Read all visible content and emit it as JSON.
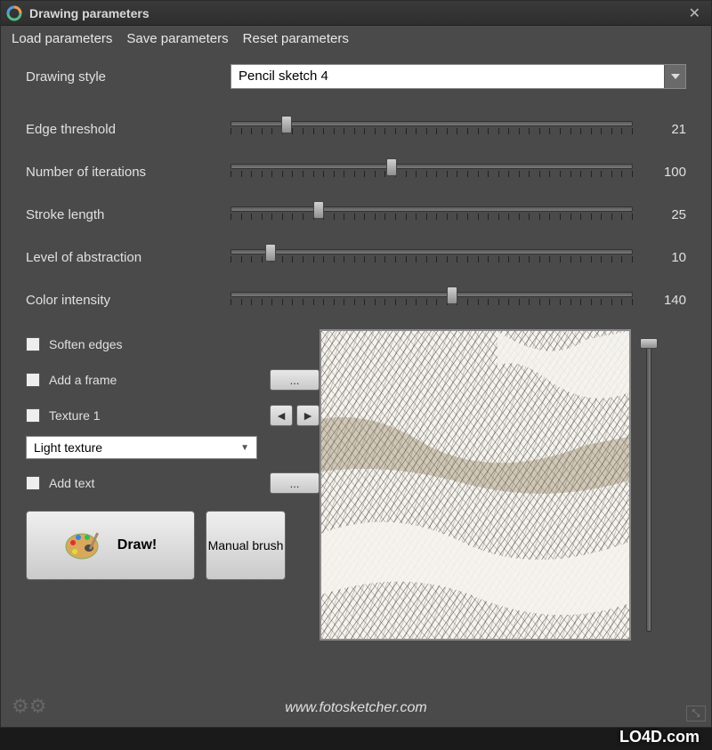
{
  "window": {
    "title": "Drawing parameters"
  },
  "menu": {
    "load": "Load parameters",
    "save": "Save parameters",
    "reset": "Reset parameters"
  },
  "style": {
    "label": "Drawing style",
    "value": "Pencil sketch 4"
  },
  "sliders": [
    {
      "label": "Edge threshold",
      "value": 21,
      "pct": 14
    },
    {
      "label": "Number of iterations",
      "value": 100,
      "pct": 40
    },
    {
      "label": "Stroke length",
      "value": 25,
      "pct": 22
    },
    {
      "label": "Level of abstraction",
      "value": 10,
      "pct": 10
    },
    {
      "label": "Color intensity",
      "value": 140,
      "pct": 55
    }
  ],
  "options": {
    "soften": "Soften edges",
    "frame": "Add a frame",
    "frame_btn": "...",
    "texture": "Texture 1",
    "texture_sel": "Light texture",
    "addtext": "Add text",
    "addtext_btn": "..."
  },
  "buttons": {
    "draw": "Draw!",
    "manual": "Manual brush"
  },
  "footer": {
    "url": "www.fotosketcher.com"
  },
  "watermark": "LO4D.com"
}
